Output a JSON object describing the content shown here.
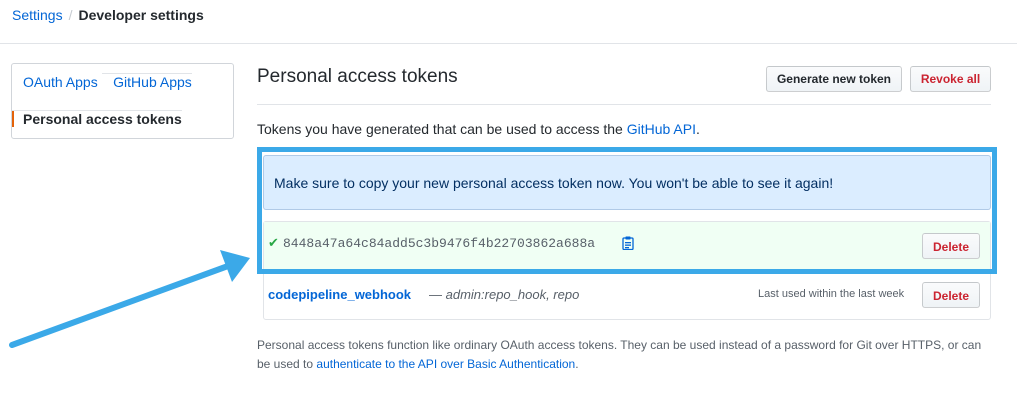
{
  "breadcrumb": {
    "root": "Settings",
    "separator": "/",
    "current": "Developer settings"
  },
  "sidebar": {
    "items": [
      {
        "label": "OAuth Apps"
      },
      {
        "label": "GitHub Apps"
      },
      {
        "label": "Personal access tokens",
        "selected": true
      }
    ]
  },
  "header": {
    "title": "Personal access tokens",
    "generate_label": "Generate new token",
    "revoke_label": "Revoke all"
  },
  "description": {
    "text": "Tokens you have generated that can be used to access the ",
    "link": "GitHub API",
    "suffix": "."
  },
  "flash": {
    "message": "Make sure to copy your new personal access token now. You won't be able to see it again!"
  },
  "new_token": {
    "value": "8448a47a64c84add5c3b9476f4b22703862a688a",
    "delete_label": "Delete",
    "check_icon": "check-icon",
    "copy_icon": "clipboard-icon"
  },
  "tokens": [
    {
      "name": "codepipeline_webhook",
      "dash": " — ",
      "scopes": "admin:repo_hook, repo",
      "last_used": "Last used within the last week",
      "delete_label": "Delete"
    }
  ],
  "footnote": {
    "text": "Personal access tokens function like ordinary OAuth access tokens. They can be used instead of a password for Git over HTTPS, or can be used to ",
    "link": "authenticate to the API over Basic Authentication",
    "suffix": "."
  },
  "colors": {
    "link": "#0366d6",
    "danger": "#cb2431",
    "highlight": "#3ba9e8",
    "success": "#28a745",
    "flash_bg": "#dbedff"
  }
}
